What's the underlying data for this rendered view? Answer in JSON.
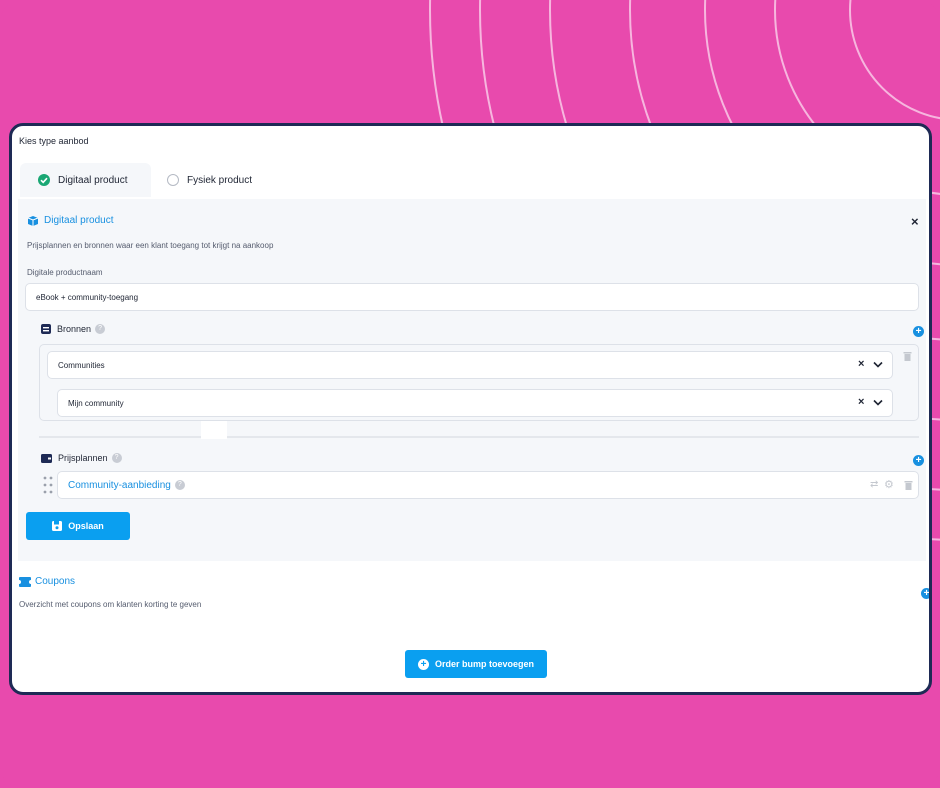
{
  "header": {
    "title": "Kies type aanbod"
  },
  "tabs": [
    {
      "label": "Digitaal product",
      "selected": true
    },
    {
      "label": "Fysiek product",
      "selected": false
    }
  ],
  "digital": {
    "title": "Digitaal product",
    "description": "Prijsplannen en bronnen waar een klant toegang tot krijgt na aankoop",
    "name_label": "Digitale productnaam",
    "name_value": "eBook + community-toegang",
    "close_glyph": "×"
  },
  "sources": {
    "title": "Bronnen",
    "type_value": "Communities",
    "item_value": "Mijn community"
  },
  "pricing": {
    "title": "Prijsplannen",
    "plan_label": "Community-aanbieding"
  },
  "actions": {
    "save_label": "Opslaan",
    "order_bump_label": "Order bump toevoegen"
  },
  "coupons": {
    "title": "Coupons",
    "description": "Overzicht met coupons om klanten korting te geven"
  },
  "colors": {
    "background": "#e84aad",
    "accent": "#0a9ff0",
    "border": "#1e2a55",
    "check": "#1aa774"
  }
}
